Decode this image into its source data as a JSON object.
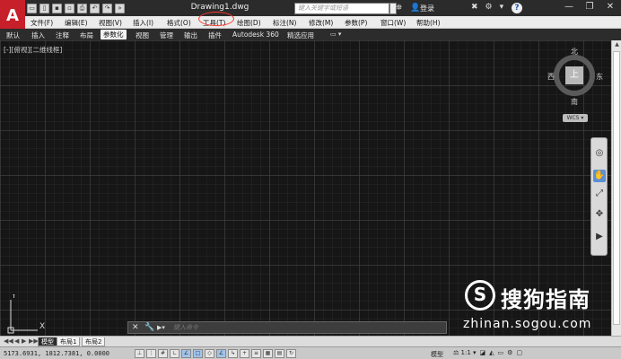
{
  "titlebar": {
    "document_title": "Drawing1.dwg",
    "search_placeholder": "键入关键字或短语",
    "login_label": "登录",
    "help_label": "?",
    "minimize": "—",
    "restore": "❐",
    "close": "✕"
  },
  "app_logo": "A",
  "menubar": {
    "items": [
      "文件(F)",
      "编辑(E)",
      "视图(V)",
      "插入(I)",
      "格式(O)",
      "工具(T)",
      "绘图(D)",
      "标注(N)",
      "修改(M)",
      "参数(P)",
      "窗口(W)",
      "帮助(H)"
    ]
  },
  "ribbon": {
    "tabs": [
      "默认",
      "插入",
      "注释",
      "布局",
      "参数化",
      "视图",
      "管理",
      "输出",
      "插件",
      "Autodesk 360",
      "精选应用"
    ],
    "active_tab": "参数化",
    "extra": "▭ ▾"
  },
  "viewport": {
    "label": "[-][俯视][二维线框]"
  },
  "viewcube": {
    "face": "上",
    "north": "北",
    "south": "南",
    "east": "东",
    "west": "西",
    "wcs": "WCS ▾"
  },
  "ucs": {
    "x_label": "X",
    "y_label": "Y"
  },
  "command_line": {
    "placeholder": "键入命令",
    "close": "✕",
    "wrench": "🔧",
    "prompt": "▶▾"
  },
  "watermark": {
    "logo": "S",
    "brand": "搜狗指南",
    "url": "zhinan.sogou.com"
  },
  "layout_tabs": {
    "nav": [
      "◀◀",
      "◀",
      "▶",
      "▶▶"
    ],
    "tabs": [
      "模型",
      "布局1",
      "布局2"
    ],
    "active": "模型"
  },
  "statusbar": {
    "coords": "5173.6931, 1812.7381, 0.0000",
    "model_label": "模型",
    "scale": "⚖ 1:1 ▾",
    "right_icons": [
      "◪",
      "◭",
      "▭",
      "⚙",
      "▢"
    ]
  },
  "colors": {
    "accent": "#c8202a",
    "highlight_circle": "#ff3a30",
    "canvas": "#161616"
  }
}
